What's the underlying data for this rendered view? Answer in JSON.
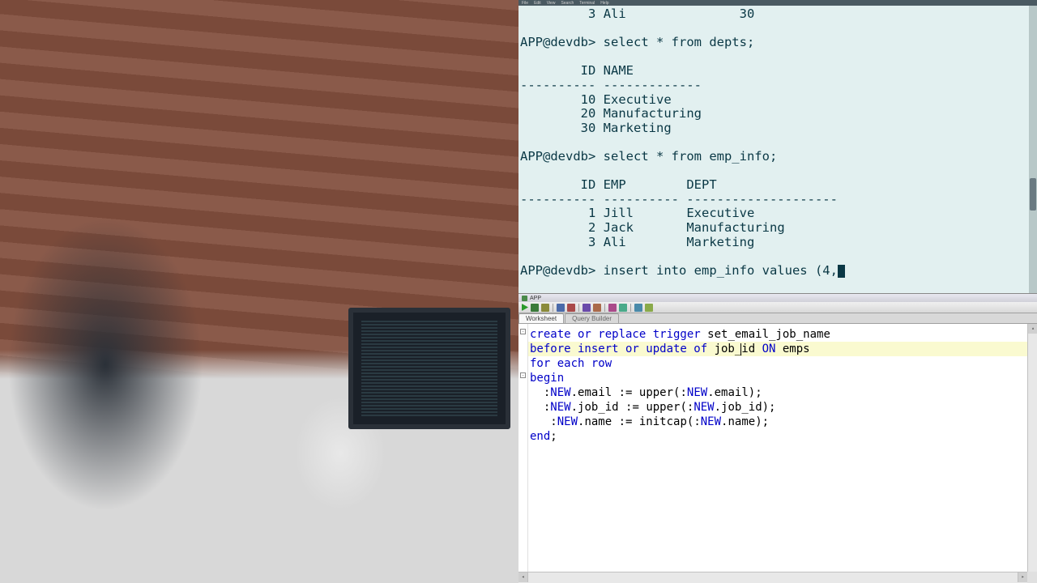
{
  "terminal": {
    "menu": [
      "File",
      "Edit",
      "View",
      "Search",
      "Terminal",
      "Help"
    ],
    "prompt": "APP@devdb>",
    "prev_row": {
      "id": "3",
      "name": "Ali",
      "col3": "30"
    },
    "cmd_depts": "select * from depts;",
    "depts_header": {
      "id": "ID",
      "name": "NAME"
    },
    "divider_depts": "---------- -------------",
    "depts_rows": [
      {
        "id": "10",
        "name": "Executive"
      },
      {
        "id": "20",
        "name": "Manufacturing"
      },
      {
        "id": "30",
        "name": "Marketing"
      }
    ],
    "cmd_empinfo": "select * from emp_info;",
    "empinfo_header": {
      "id": "ID",
      "emp": "EMP",
      "dept": "DEPT"
    },
    "divider_emp": "---------- ---------- --------------------",
    "empinfo_rows": [
      {
        "id": "1",
        "emp": "Jill",
        "dept": "Executive"
      },
      {
        "id": "2",
        "emp": "Jack",
        "dept": "Manufacturing"
      },
      {
        "id": "3",
        "emp": "Ali",
        "dept": "Marketing"
      }
    ],
    "cmd_insert": "insert into emp_info values (4,"
  },
  "sqldev": {
    "title": "APP",
    "tabs": {
      "worksheet": "Worksheet",
      "querybuilder": "Query Builder"
    },
    "toolbar_icons": [
      "run-icon",
      "run-script-icon",
      "commit-icon",
      "sep",
      "autocommit-icon",
      "rollback-icon",
      "sep",
      "explain-icon",
      "autotrace-icon",
      "sep",
      "sql-history-icon",
      "clear-icon",
      "sep",
      "snippets-icon",
      "format-icon"
    ],
    "code": {
      "l1a": "create or replace trigger ",
      "l1b": "set_email_job_name",
      "l2a": "before insert or update of ",
      "l2b": "job_id ",
      "l2c": "ON",
      "l2d": " emps",
      "l3": "for each row",
      "l4": "begin",
      "l5a": "  :",
      "l5b": "NEW",
      "l5c": ".email := ",
      "l5d": "upper",
      "l5e": "(:",
      "l5f": "NEW",
      "l5g": ".email);",
      "l6a": "  :",
      "l6b": "NEW",
      "l6c": ".job_id := ",
      "l6d": "upper",
      "l6e": "(:",
      "l6f": "NEW",
      "l6g": ".job_id);",
      "l7a": "   :",
      "l7b": "NEW",
      "l7c": ".name := ",
      "l7d": "initcap",
      "l7e": "(:",
      "l7f": "NEW",
      "l7g": ".name);",
      "l8": "end",
      "l8b": ";"
    }
  }
}
